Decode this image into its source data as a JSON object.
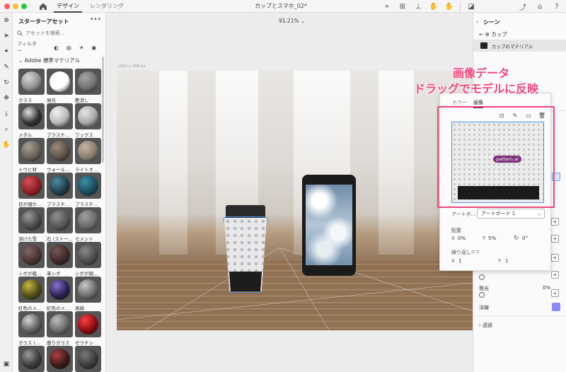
{
  "titlebar": {
    "tab_design": "デザイン",
    "tab_render": "レンダリング",
    "document_title": "カップとスマホ_02*"
  },
  "assets": {
    "title": "スターターアセット",
    "more": "•••",
    "search_placeholder": "アセットを検索...",
    "filter_label": "フィルター",
    "section_title": "Adobe 標準マテリアル",
    "materials": [
      {
        "label": "ガラス",
        "color": "#8e8e8e",
        "highlight": "#d9d9d9"
      },
      {
        "label": "発光",
        "color": "#ffffff",
        "highlight": "#ffffff"
      },
      {
        "label": "艶消し",
        "color": "#707070",
        "highlight": "#a5a5a5"
      },
      {
        "label": "メタル",
        "color": "#303030",
        "highlight": "#e0e0e0"
      },
      {
        "label": "プラスチ…",
        "color": "#b8b8b8",
        "highlight": "#f2f2f2"
      },
      {
        "label": "ワックス",
        "color": "#a8a8a8",
        "highlight": "#e6e6e6"
      },
      {
        "label": "トウヒ材",
        "color": "#6a6258",
        "highlight": "#a8a095"
      },
      {
        "label": "ウォール…",
        "color": "#5c5148",
        "highlight": "#9a8c7e"
      },
      {
        "label": "ライトオ…",
        "color": "#8a7d6e",
        "highlight": "#c4b6a5"
      },
      {
        "label": "目が細か…",
        "color": "#8c1f24",
        "highlight": "#d45055"
      },
      {
        "label": "プラスチ…",
        "color": "#1f3c4a",
        "highlight": "#4f8ca0"
      },
      {
        "label": "プラスチ…",
        "color": "#1a4c5c",
        "highlight": "#3c8fa5"
      },
      {
        "label": "溶けた雪",
        "color": "#4a4a4a",
        "highlight": "#9a9a9a"
      },
      {
        "label": "石 (ストー…",
        "color": "#555555",
        "highlight": "#8f8f8f"
      },
      {
        "label": "セメント",
        "color": "#6a6a6a",
        "highlight": "#a0a0a0"
      },
      {
        "label": "シボが粗…",
        "color": "#4a3434",
        "highlight": "#806565"
      },
      {
        "label": "革シボ",
        "color": "#3f2828",
        "highlight": "#765656"
      },
      {
        "label": "シボが細…",
        "color": "#4c4c4c",
        "highlight": "#8a8a8a"
      },
      {
        "label": "虹色のメ…",
        "color": "#4d4a18",
        "highlight": "#c8b840"
      },
      {
        "label": "虹色のメ…",
        "color": "#2a2050",
        "highlight": "#8a70d0"
      },
      {
        "label": "真鍮",
        "color": "#6a6a6a",
        "highlight": "#c8c8c8"
      },
      {
        "label": "ガラス (…",
        "color": "#5e5e5e",
        "highlight": "#d6d6d6"
      },
      {
        "label": "曇りガラス",
        "color": "#6a6a6a",
        "highlight": "#bdbdbd"
      },
      {
        "label": "ゼラチン",
        "color": "#8a0b10",
        "highlight": "#ff4040"
      },
      {
        "label": "",
        "color": "#3a3a3a",
        "highlight": "#9a9a9a"
      },
      {
        "label": "",
        "color": "#3a1a1a",
        "highlight": "#b04040"
      },
      {
        "label": "",
        "color": "#3a3a3a",
        "highlight": "#7a7a7a"
      }
    ]
  },
  "canvas": {
    "zoom": "91.21%",
    "size_label": "1024 x 768 px"
  },
  "annotation": {
    "line1": "画像データ",
    "line2": "ドラッグでモデルに反映"
  },
  "props": {
    "title": "シーン",
    "breadcrumb": "カップ",
    "material_row": "カップのマテリアル",
    "emission_label": "発光",
    "emission_value": "0%",
    "normal_label": "法線",
    "transparency_label": "透過",
    "normal_color": "#8b8bfa"
  },
  "popup": {
    "tab_color": "カラー",
    "tab_image": "画像",
    "pattern_tag": "pattern.ai",
    "artboard_label": "アートボ…",
    "artboard_value": "アートボード 1",
    "placement_label": "配置",
    "x_label": "X",
    "x_value": "0%",
    "y_label": "Y",
    "y_value": "5%",
    "rotation_value": "0°",
    "repeat_label": "繰り返し",
    "repeat_x_label": "X",
    "repeat_x_value": "1",
    "repeat_y_label": "Y",
    "repeat_y_value": "1"
  }
}
